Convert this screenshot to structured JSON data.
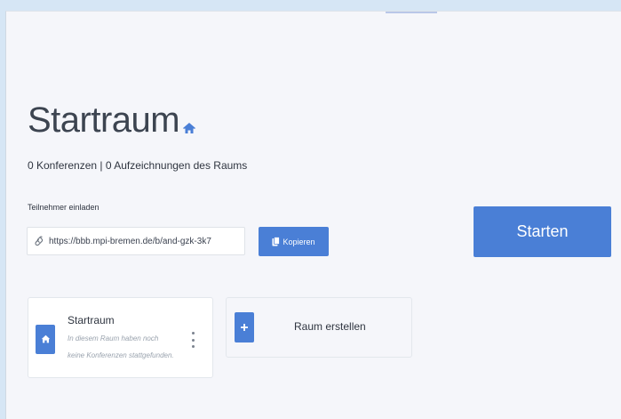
{
  "room": {
    "title": "Startraum",
    "stats": "0 Konferenzen | 0 Aufzeichnungen des Raums"
  },
  "invite": {
    "label": "Teilnehmer einladen",
    "url": "https://bbb.mpi-bremen.de/b/and-gzk-3k7",
    "copy_label": "Kopieren"
  },
  "start_label": "Starten",
  "room_card": {
    "name": "Startraum",
    "description": "In diesem Raum haben noch keine Konferenzen stattgefunden."
  },
  "create_room_label": "Raum erstellen",
  "colors": {
    "accent": "#4a7fd6",
    "background": "#f5f6fa",
    "frame": "#d6e6f5"
  },
  "icons": {
    "title": "home-icon",
    "invite": "link-icon",
    "copy": "clipboard-icon",
    "card": "home-icon",
    "menu": "more-vertical-icon",
    "create": "plus-icon"
  }
}
